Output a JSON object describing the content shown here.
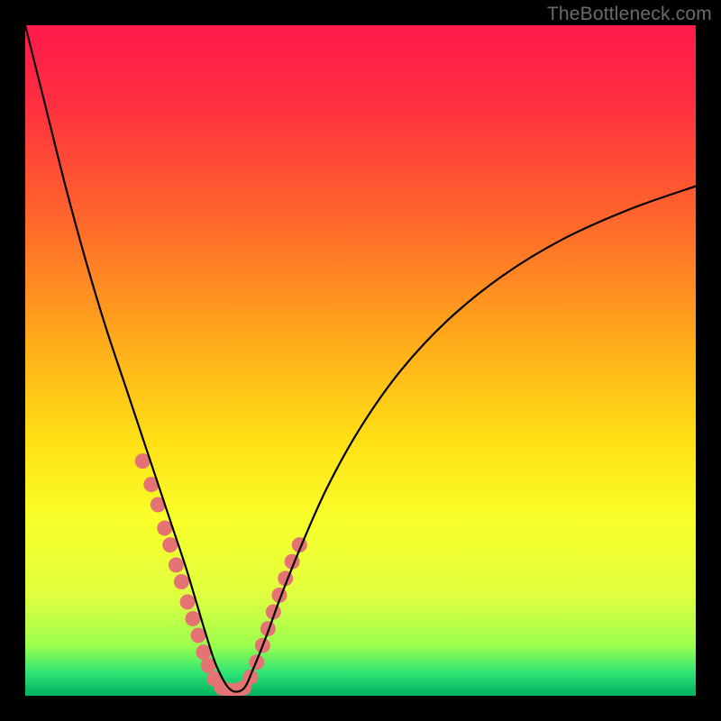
{
  "watermark": {
    "text": "TheBottleneck.com"
  },
  "chart_data": {
    "type": "line",
    "title": "",
    "xlabel": "",
    "ylabel": "",
    "xlim": [
      0,
      100
    ],
    "ylim": [
      0,
      100
    ],
    "grid": false,
    "legend": false,
    "gradient_stops": [
      {
        "pos": 0.0,
        "color": "#ff1a4b"
      },
      {
        "pos": 0.12,
        "color": "#ff3040"
      },
      {
        "pos": 0.3,
        "color": "#ff6a2a"
      },
      {
        "pos": 0.48,
        "color": "#ffae1a"
      },
      {
        "pos": 0.62,
        "color": "#ffe015"
      },
      {
        "pos": 0.74,
        "color": "#f8ff2a"
      },
      {
        "pos": 0.85,
        "color": "#e0ff40"
      },
      {
        "pos": 0.925,
        "color": "#9cff4e"
      },
      {
        "pos": 0.965,
        "color": "#30e574"
      },
      {
        "pos": 1.0,
        "color": "#00b060"
      }
    ],
    "series": [
      {
        "name": "bottleneck-curve",
        "color": "#000000",
        "stroke_width": 2.2,
        "x": [
          0.0,
          3.0,
          6.0,
          9.0,
          12.0,
          15.0,
          18.0,
          20.0,
          22.0,
          24.0,
          25.5,
          27.0,
          28.5,
          30.5,
          32.5,
          34.0,
          36.0,
          38.0,
          41.0,
          45.0,
          50.0,
          56.0,
          63.0,
          71.0,
          80.0,
          90.0,
          100.0
        ],
        "y": [
          100.0,
          88.0,
          76.0,
          65.0,
          55.0,
          46.0,
          37.0,
          31.0,
          25.0,
          19.0,
          14.0,
          9.0,
          4.5,
          1.0,
          1.0,
          4.0,
          9.0,
          14.5,
          22.0,
          31.0,
          40.0,
          48.5,
          56.0,
          62.5,
          68.0,
          72.5,
          76.0
        ]
      }
    ],
    "markers": {
      "color": "#e57373",
      "radius": 8.5,
      "points_xy": [
        [
          17.5,
          35.0
        ],
        [
          18.8,
          31.5
        ],
        [
          19.8,
          28.5
        ],
        [
          20.8,
          25.0
        ],
        [
          21.6,
          22.5
        ],
        [
          22.5,
          19.5
        ],
        [
          23.3,
          17.0
        ],
        [
          24.2,
          14.0
        ],
        [
          25.0,
          11.5
        ],
        [
          25.8,
          9.0
        ],
        [
          26.6,
          6.5
        ],
        [
          27.3,
          4.5
        ],
        [
          28.2,
          2.5
        ],
        [
          29.3,
          1.2
        ],
        [
          30.4,
          0.8
        ],
        [
          31.5,
          0.8
        ],
        [
          32.6,
          1.2
        ],
        [
          33.6,
          2.8
        ],
        [
          34.5,
          5.0
        ],
        [
          35.4,
          7.5
        ],
        [
          36.2,
          10.0
        ],
        [
          37.0,
          12.5
        ],
        [
          37.9,
          15.0
        ],
        [
          38.8,
          17.5
        ],
        [
          39.8,
          20.0
        ],
        [
          40.9,
          22.5
        ]
      ]
    }
  }
}
